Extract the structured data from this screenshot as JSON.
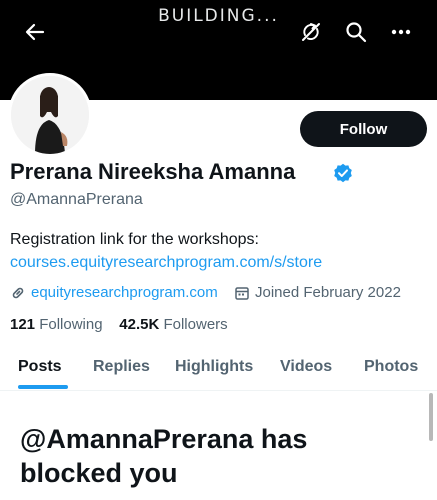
{
  "header": {
    "banner_title": "BUILDING...",
    "back_icon": "back-arrow-icon",
    "actions": [
      "refresh-icon",
      "search-icon",
      "more-icon"
    ]
  },
  "profile": {
    "avatar_icon": "avatar",
    "follow_label": "Follow",
    "name": "Prerana Nireeksha Amanna",
    "verified_icon": "verified-badge-icon",
    "handle": "@AmannaPrerana",
    "bio_line1": "Registration link for the workshops:",
    "bio_link": "courses.equityresearchprogram.com/s/store",
    "website": "equityresearchprogram.com",
    "joined": "Joined February 2022",
    "following_count": "121",
    "following_label": "Following",
    "followers_count": "42.5K",
    "followers_label": "Followers"
  },
  "tabs": [
    {
      "label": "Posts",
      "active": true
    },
    {
      "label": "Replies",
      "active": false
    },
    {
      "label": "Highlights",
      "active": false
    },
    {
      "label": "Videos",
      "active": false
    },
    {
      "label": "Photos",
      "active": false
    }
  ],
  "blocked_message": "@AmannaPrerana has blocked you",
  "colors": {
    "accent": "#1d9bf0",
    "text": "#0f1419",
    "muted": "#536471",
    "banner": "#000000"
  }
}
